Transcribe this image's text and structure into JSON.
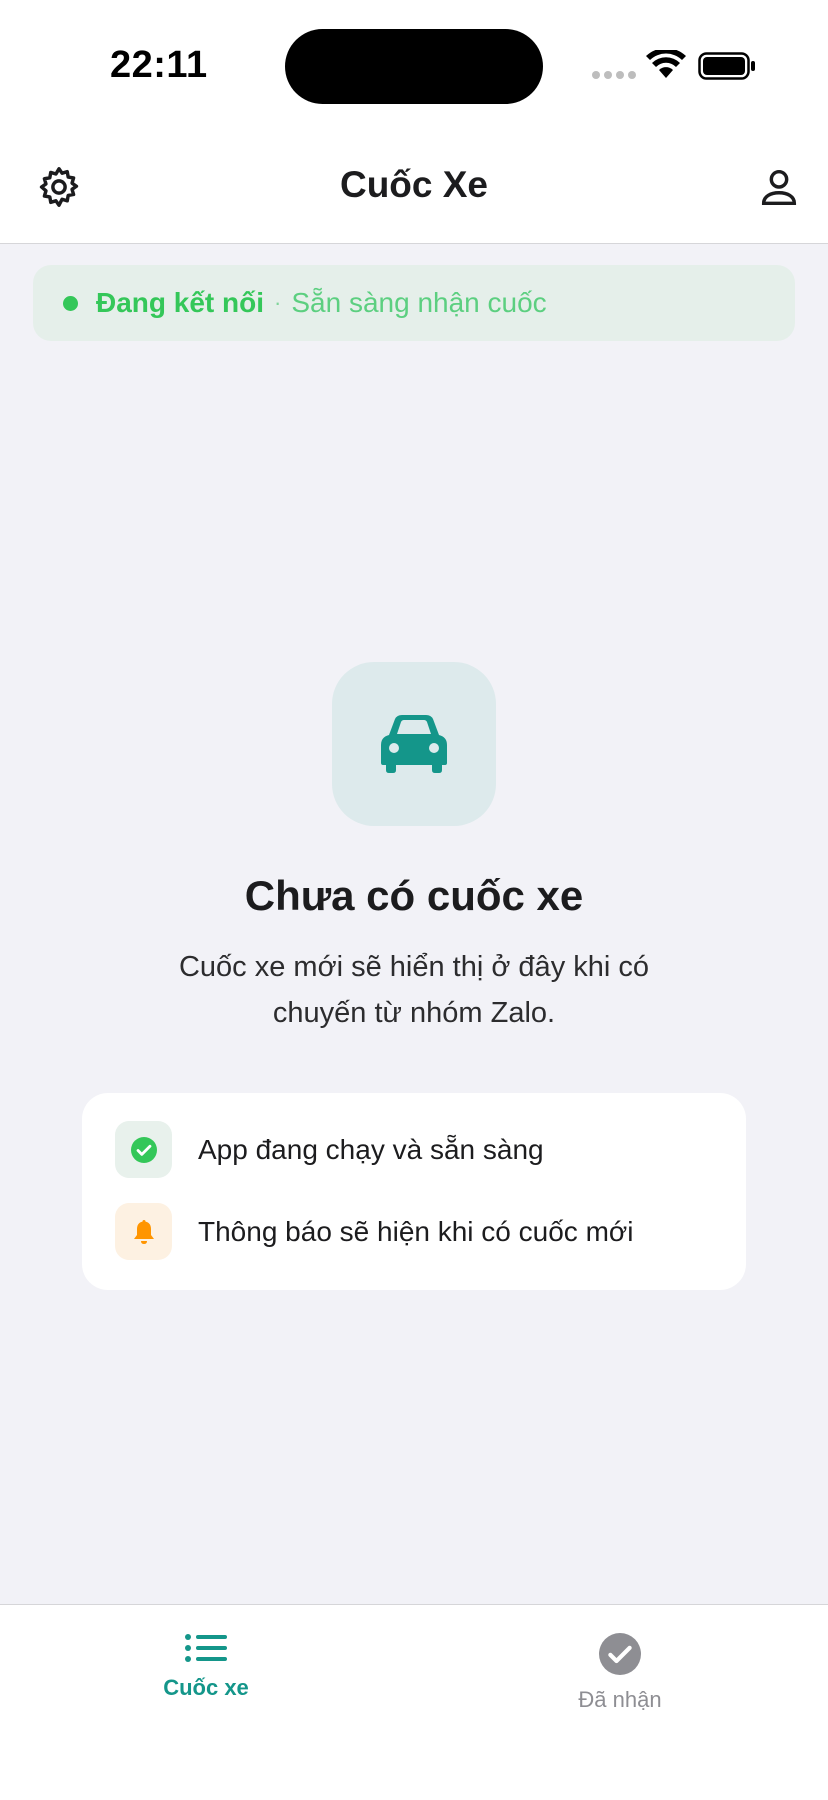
{
  "status_bar": {
    "time": "22:11"
  },
  "header": {
    "title": "Cuốc Xe",
    "settings_icon": "gear-icon",
    "profile_icon": "person-icon"
  },
  "connection": {
    "status": "Đang kết nối",
    "separator": "·",
    "subtitle": "Sẵn sàng nhận cuốc",
    "color": "#34c759"
  },
  "empty_state": {
    "icon": "car-icon",
    "title": "Chưa có cuốc xe",
    "description": "Cuốc xe mới sẽ hiển thị ở đây khi có chuyến từ nhóm Zalo."
  },
  "info_card": {
    "items": [
      {
        "icon": "check-circle-icon",
        "text": "App đang chạy và sẵn sàng"
      },
      {
        "icon": "bell-icon",
        "text": "Thông báo sẽ hiện khi có cuốc mới"
      }
    ]
  },
  "tab_bar": {
    "tabs": [
      {
        "label": "Cuốc xe",
        "icon": "list-icon",
        "active": true
      },
      {
        "label": "Đã nhận",
        "icon": "check-circle-icon",
        "active": false
      }
    ],
    "accent": "#14968a"
  }
}
